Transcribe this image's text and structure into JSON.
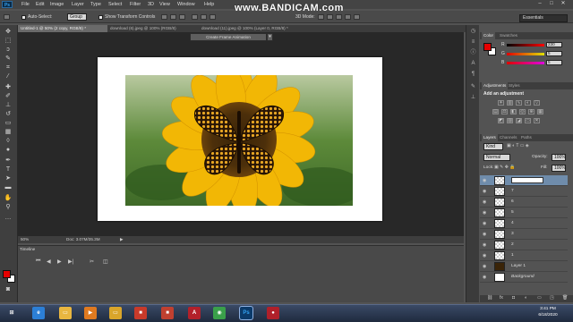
{
  "app": {
    "logo": "Ps"
  },
  "watermark": "www.BANDICAM.com",
  "menu": [
    "File",
    "Edit",
    "Image",
    "Layer",
    "Type",
    "Select",
    "Filter",
    "3D",
    "View",
    "Window",
    "Help"
  ],
  "window_controls": [
    "–",
    "□",
    "✕"
  ],
  "options_bar": {
    "auto_select_label": "Auto-Select:",
    "auto_select_value": "Group",
    "transform_label": "Show Transform Controls",
    "mode_label": "3D Mode:"
  },
  "workspace_preset": "Essentials",
  "tabs": [
    {
      "label": "Untitled-1 @ 50% (2 copy, RGB/8) *",
      "active": true
    },
    {
      "label": "download (6).jpeg @ 100% (RGB/8)",
      "active": false
    },
    {
      "label": "download (11).jpeg @ 100% (Layer 0, RGB/8) *",
      "active": false
    }
  ],
  "status": {
    "zoom": "50%",
    "doc": "Doc: 3.07M/35.3M"
  },
  "timeline": {
    "tab": "Timeline",
    "create_button": "Create Frame Animation",
    "dropdown": "▾"
  },
  "panels": {
    "color_tabs": [
      "Color",
      "Swatches"
    ],
    "color": {
      "fg": "#e60000",
      "bg": "#ffffff",
      "channels": [
        {
          "label": "R",
          "value": "230"
        },
        {
          "label": "G",
          "value": "5"
        },
        {
          "label": "B",
          "value": "5"
        }
      ]
    },
    "adjust_tabs": [
      "Adjustments",
      "Styles"
    ],
    "adjust_title": "Add an adjustment",
    "layers_tabs": [
      "Layers",
      "Channels",
      "Paths"
    ],
    "filter_kind": "Kind",
    "blend_mode": "Normal",
    "opacity_label": "Opacity:",
    "opacity_value": "100%",
    "lock_label": "Lock:",
    "fill_label": "Fill:",
    "fill_value": "100%",
    "layers": [
      {
        "name": "",
        "selected": true,
        "editing": true
      },
      {
        "name": "7",
        "selected": false
      },
      {
        "name": "6",
        "selected": false
      },
      {
        "name": "5",
        "selected": false
      },
      {
        "name": "4",
        "selected": false
      },
      {
        "name": "3",
        "selected": false
      },
      {
        "name": "2",
        "selected": false
      },
      {
        "name": "1",
        "selected": false
      },
      {
        "name": "Layer 1",
        "selected": false,
        "thumb": "butterfly"
      },
      {
        "name": "Background",
        "selected": false,
        "thumb": "white",
        "italic": true
      }
    ]
  },
  "taskbar": {
    "apps": [
      {
        "name": "windows-start",
        "color": "#4aa0e6",
        "glyph": "⊞"
      },
      {
        "name": "internet-explorer",
        "color": "#2c7fd6",
        "glyph": "e"
      },
      {
        "name": "file-explorer",
        "color": "#e8b640",
        "glyph": "▭"
      },
      {
        "name": "media-player",
        "color": "#e07a20",
        "glyph": "▶"
      },
      {
        "name": "folder-yellow",
        "color": "#d9a52a",
        "glyph": "▭"
      },
      {
        "name": "app-red-1",
        "color": "#c83a2a",
        "glyph": "■"
      },
      {
        "name": "app-red-2",
        "color": "#c04030",
        "glyph": "■"
      },
      {
        "name": "acrobat",
        "color": "#b3202a",
        "glyph": "A"
      },
      {
        "name": "opera",
        "color": "#d8202a",
        "glyph": "O"
      },
      {
        "name": "chrome",
        "color": "#3aa04a",
        "glyph": "◉"
      },
      {
        "name": "mozilla",
        "color": "#4c6aa8",
        "glyph": "◍"
      },
      {
        "name": "photoshop",
        "color": "#0b3a6a",
        "glyph": "Ps"
      },
      {
        "name": "bandicam",
        "color": "#b0202a",
        "glyph": "●"
      }
    ],
    "time": "3:41 PM",
    "date": "6/18/2020"
  }
}
